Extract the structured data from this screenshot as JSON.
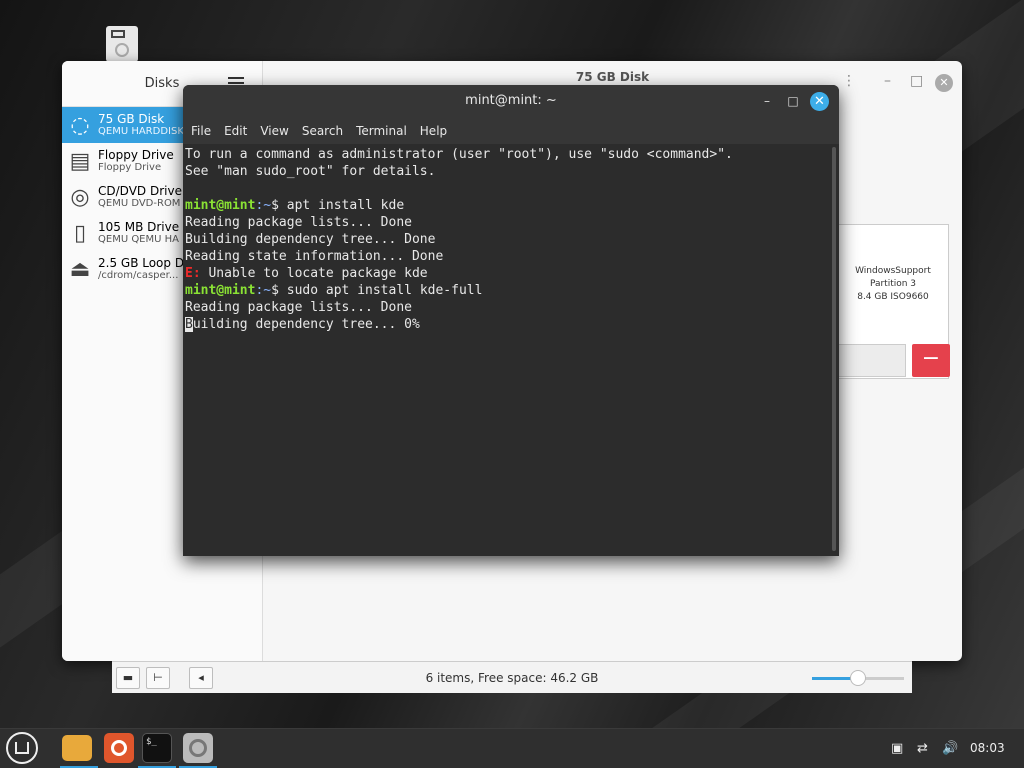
{
  "desktop": {
    "icon": "drive-icon"
  },
  "disks": {
    "title": "Disks",
    "header_title": "75 GB Disk",
    "drives": [
      {
        "name": "75 GB Disk",
        "sub": "QEMU HARDDISK",
        "icon": "harddisk-icon",
        "selected": true
      },
      {
        "name": "Floppy Drive",
        "sub": "Floppy Drive",
        "icon": "floppy-icon",
        "selected": false
      },
      {
        "name": "CD/DVD Drive",
        "sub": "QEMU DVD-ROM",
        "icon": "cdrom-icon",
        "selected": false
      },
      {
        "name": "105 MB Drive",
        "sub": "QEMU QEMU HA",
        "icon": "usb-icon",
        "selected": false
      },
      {
        "name": "2.5 GB Loop D",
        "sub": "/cdrom/casper...",
        "icon": "eject-icon",
        "selected": false
      }
    ],
    "partition": {
      "name": "WindowsSupport",
      "label": "Partition 3",
      "size": "8.4 GB ISO9660"
    },
    "minus_label": "−"
  },
  "file_manager": {
    "status": "6 items, Free space: 46.2 GB",
    "zoom_fraction": 0.5
  },
  "terminal": {
    "title": "mint@mint: ~",
    "menu": [
      "File",
      "Edit",
      "View",
      "Search",
      "Terminal",
      "Help"
    ],
    "lines": [
      "To run a command as administrator (user \"root\"), use \"sudo <command>\".",
      "See \"man sudo_root\" for details.",
      "",
      {
        "prompt": "mint@mint",
        "path": ":~",
        "cmd": "$ apt install kde"
      },
      "Reading package lists... Done",
      "Building dependency tree... Done",
      "Reading state information... Done",
      {
        "error": "E:",
        "text": " Unable to locate package kde"
      },
      {
        "prompt": "mint@mint",
        "path": ":~",
        "cmd": "$ sudo apt install kde-full"
      },
      "Reading package lists... Done",
      {
        "cursor": "B",
        "text": "uilding dependency tree... 0%"
      }
    ]
  },
  "taskbar": {
    "apps": [
      "mint-menu-icon",
      "files-icon",
      "firefox-icon",
      "terminal-icon",
      "disks-icon"
    ],
    "clock": "08:03"
  }
}
